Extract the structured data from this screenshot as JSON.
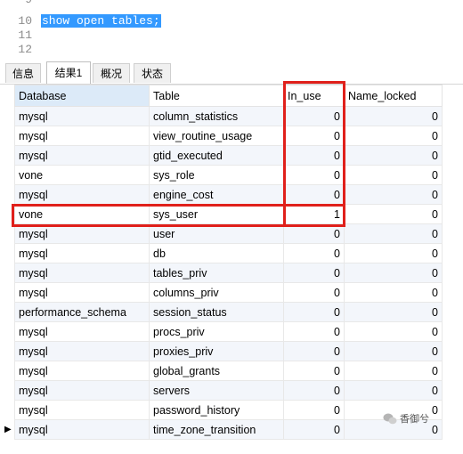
{
  "editor": {
    "lines": [
      {
        "num": "10",
        "code": "show open tables;"
      },
      {
        "num": "11",
        "code": ""
      },
      {
        "num": "12",
        "code": ""
      }
    ]
  },
  "tabs": [
    {
      "label": "信息",
      "active": false
    },
    {
      "label": "结果1",
      "active": true
    },
    {
      "label": "概况",
      "active": false
    },
    {
      "label": "状态",
      "active": false
    }
  ],
  "table": {
    "columns": [
      "Database",
      "Table",
      "In_use",
      "Name_locked"
    ],
    "rows": [
      [
        "mysql",
        "column_statistics",
        "0",
        "0"
      ],
      [
        "mysql",
        "view_routine_usage",
        "0",
        "0"
      ],
      [
        "mysql",
        "gtid_executed",
        "0",
        "0"
      ],
      [
        "vone",
        "sys_role",
        "0",
        "0"
      ],
      [
        "mysql",
        "engine_cost",
        "0",
        "0"
      ],
      [
        "vone",
        "sys_user",
        "1",
        "0"
      ],
      [
        "mysql",
        "user",
        "0",
        "0"
      ],
      [
        "mysql",
        "db",
        "0",
        "0"
      ],
      [
        "mysql",
        "tables_priv",
        "0",
        "0"
      ],
      [
        "mysql",
        "columns_priv",
        "0",
        "0"
      ],
      [
        "performance_schema",
        "session_status",
        "0",
        "0"
      ],
      [
        "mysql",
        "procs_priv",
        "0",
        "0"
      ],
      [
        "mysql",
        "proxies_priv",
        "0",
        "0"
      ],
      [
        "mysql",
        "global_grants",
        "0",
        "0"
      ],
      [
        "mysql",
        "servers",
        "0",
        "0"
      ],
      [
        "mysql",
        "password_history",
        "0",
        "0"
      ],
      [
        "mysql",
        "time_zone_transition",
        "0",
        "0"
      ]
    ],
    "current_row_indicator": "▶"
  },
  "watermark": {
    "text": "香御兮"
  },
  "colors": {
    "selection": "#3399ff",
    "highlight_box": "#e0201b",
    "header_active": "#dceaf8"
  }
}
